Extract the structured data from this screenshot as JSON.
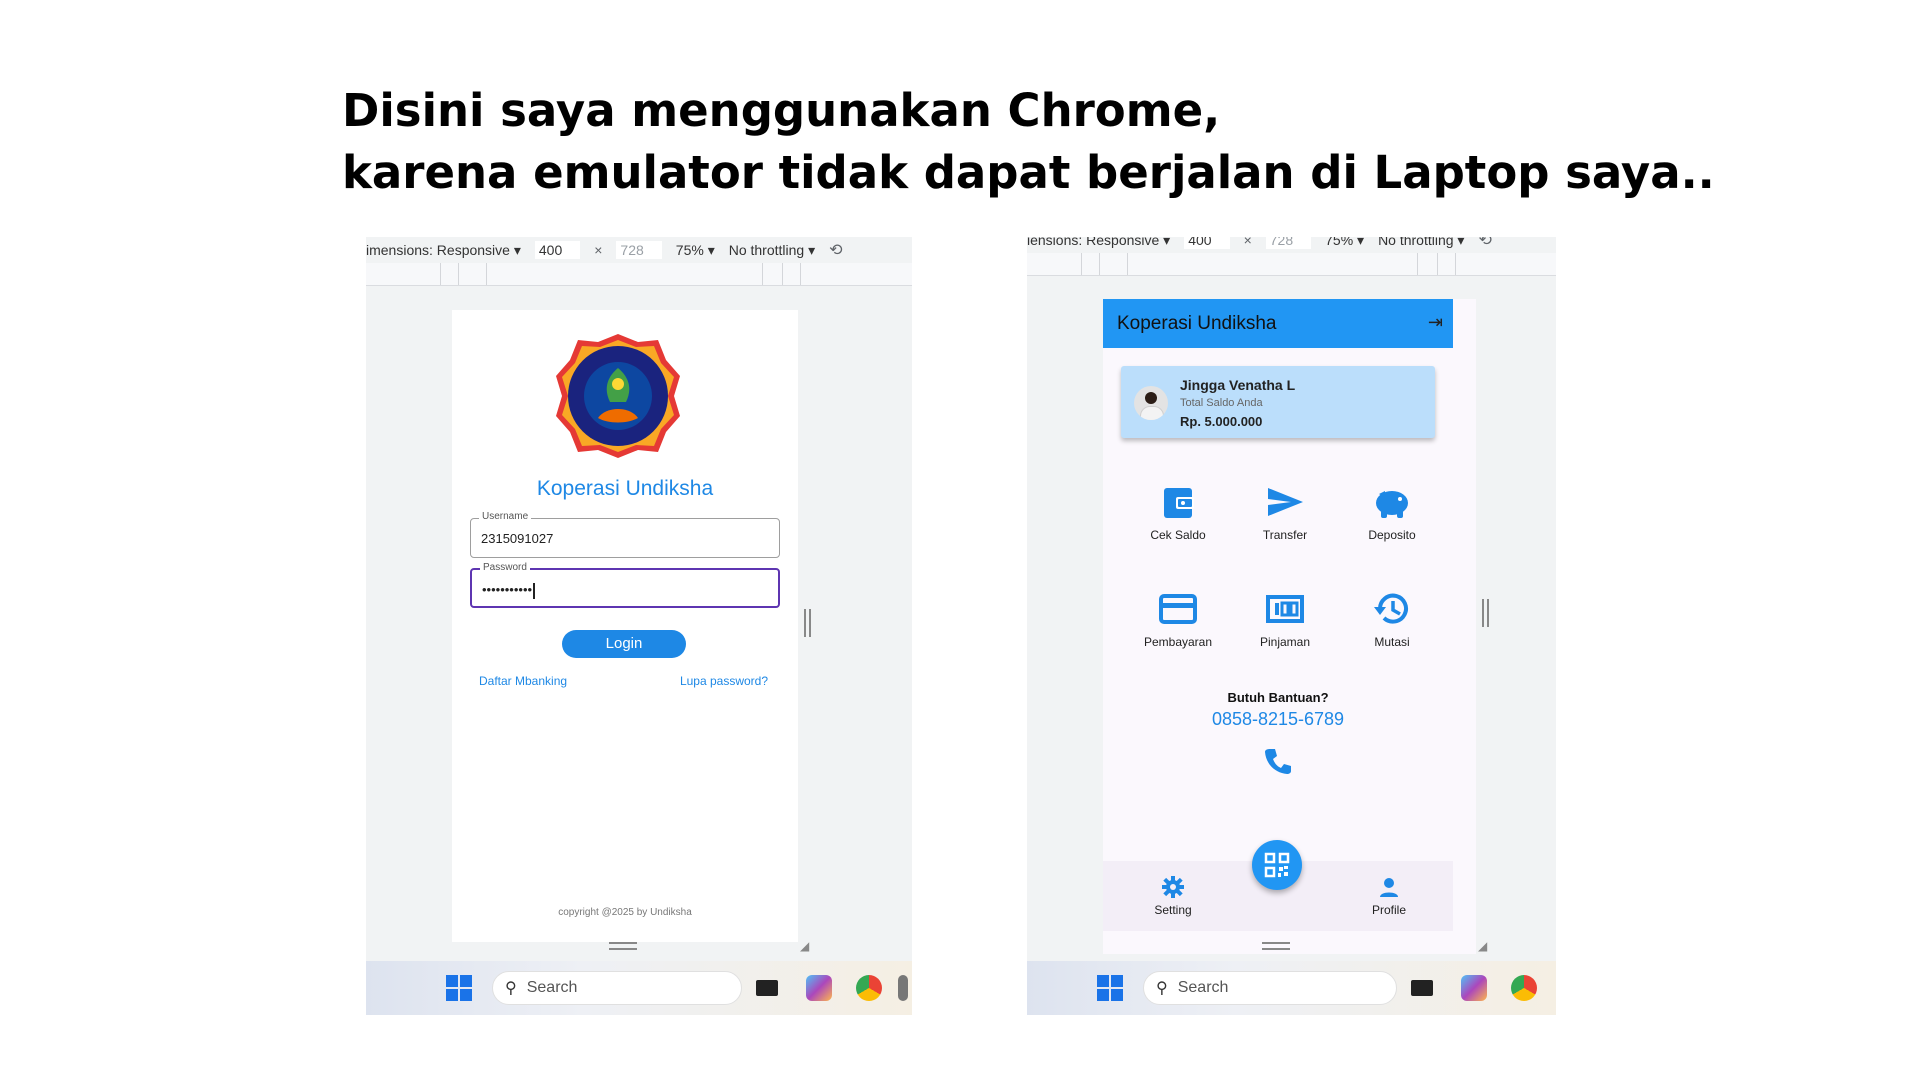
{
  "heading": {
    "line1": "Disini saya menggunakan Chrome,",
    "line2": "karena emulator tidak dapat berjalan di Laptop saya.."
  },
  "left_devtools": {
    "dimensions": "imensions: Responsive ▾",
    "width": "400",
    "times": "×",
    "height": "728",
    "zoom": "75% ▾",
    "throttle": "No throttling ▾"
  },
  "right_devtools": {
    "dimensions": "iensions: Responsive ▾",
    "width": "400",
    "times": "×",
    "height": "728",
    "zoom": "75% ▾",
    "throttle": "No throttling ▾"
  },
  "taskbar": {
    "search_label": "Search"
  },
  "login": {
    "title": "Koperasi Undiksha",
    "username_label": "Username",
    "username_value": "2315091027",
    "password_label": "Password",
    "password_value": "•••••••••••",
    "login_button": "Login",
    "register_link": "Daftar Mbanking",
    "forgot_link": "Lupa password?",
    "copyright": "copyright @2025 by Undiksha"
  },
  "home": {
    "appbar_title": "Koperasi Undiksha",
    "account": {
      "name": "Jingga Venatha L",
      "balance_label": "Total Saldo Anda",
      "balance": "Rp. 5.000.000"
    },
    "menu": [
      {
        "label": "Cek Saldo",
        "icon": "wallet-icon"
      },
      {
        "label": "Transfer",
        "icon": "send-icon"
      },
      {
        "label": "Deposito",
        "icon": "piggy-bank-icon"
      },
      {
        "label": "Pembayaran",
        "icon": "credit-card-icon"
      },
      {
        "label": "Pinjaman",
        "icon": "money-icon"
      },
      {
        "label": "Mutasi",
        "icon": "history-icon"
      }
    ],
    "help_title": "Butuh Bantuan?",
    "help_phone": "0858-8215-6789",
    "nav": {
      "setting": "Setting",
      "profile": "Profile"
    }
  },
  "colors": {
    "primary_blue": "#2196f3",
    "link_blue": "#1e88e5",
    "card_blue": "#bbdefb",
    "focus_purple": "#5e35b1"
  }
}
